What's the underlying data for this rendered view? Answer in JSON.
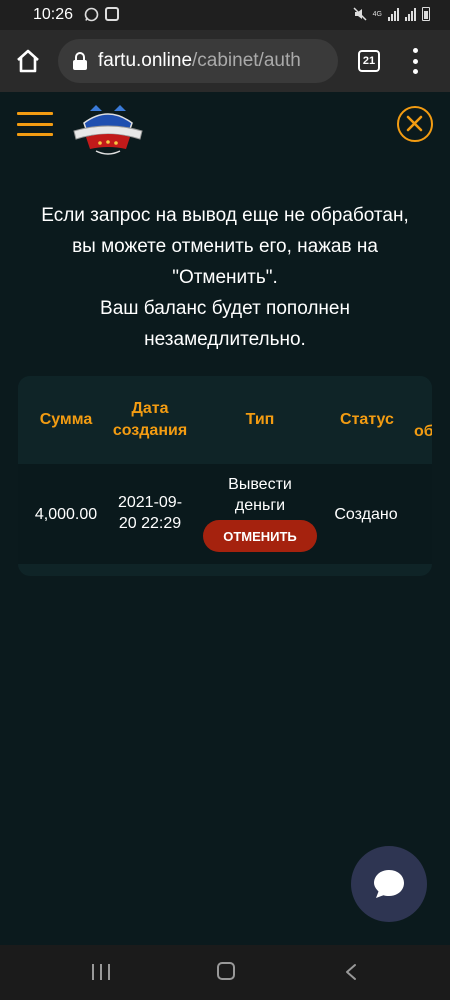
{
  "status_bar": {
    "time": "10:26",
    "network_label": "4G"
  },
  "browser": {
    "url_domain": "fartu.online",
    "url_path": "/cabinet/auth",
    "tab_count": "21"
  },
  "info": {
    "lines": [
      "Если запрос на вывод еще не обработан,",
      "вы можете отменить его, нажав на",
      "\"Отменить\".",
      "Ваш баланс будет пополнен",
      "незамедлительно."
    ]
  },
  "table": {
    "headers": [
      "Сумма",
      "Дата создания",
      "Тип",
      "Статус",
      "об"
    ],
    "rows": [
      {
        "amount": "4,000.00",
        "date": "2021-09-20 22:29",
        "type": "Вывести деньги",
        "status": "Создано",
        "action_label": "ОТМЕНИТЬ"
      }
    ]
  },
  "colors": {
    "accent": "#f39c12",
    "background": "#0b1a1d",
    "cancel_button": "#a5220e",
    "chat_button": "#2e3552"
  },
  "icons": {
    "menu": "hamburger-icon",
    "close": "close-icon",
    "chat": "chat-bubble-icon",
    "logo": "casino-logo"
  }
}
